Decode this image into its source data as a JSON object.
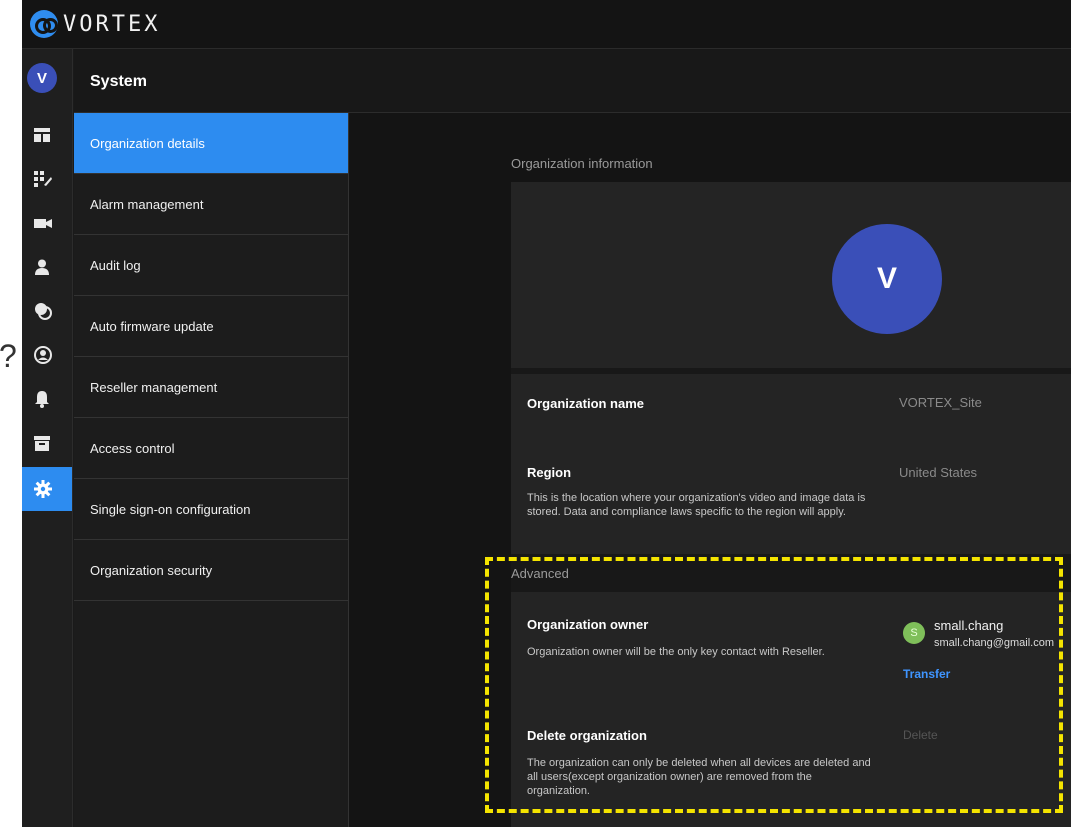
{
  "app": {
    "brand": "VORTEX"
  },
  "rail": {
    "avatar_letter": "V",
    "items": [
      {
        "icon": "dashboard-icon"
      },
      {
        "icon": "apps-icon"
      },
      {
        "icon": "camera-icon"
      },
      {
        "icon": "user-icon"
      },
      {
        "icon": "integration-icon"
      },
      {
        "icon": "account-circle-icon"
      },
      {
        "icon": "bell-icon"
      },
      {
        "icon": "archive-icon"
      },
      {
        "icon": "gear-icon",
        "active": true
      }
    ],
    "accent": "#2d8cf0"
  },
  "header": {
    "title": "System"
  },
  "menu": {
    "items": [
      {
        "label": "Organization details",
        "active": true
      },
      {
        "label": "Alarm management"
      },
      {
        "label": "Audit log"
      },
      {
        "label": "Auto firmware update"
      },
      {
        "label": "Reseller management"
      },
      {
        "label": "Access control"
      },
      {
        "label": "Single sign-on configuration"
      },
      {
        "label": "Organization security"
      }
    ]
  },
  "org_info": {
    "section_label": "Organization information",
    "avatar_letter": "V",
    "name_label": "Organization name",
    "name_value": "VORTEX_Site",
    "region_label": "Region",
    "region_desc_line1": "This is the location where your organization's video and image data is",
    "region_desc_line2": "stored. Data and compliance laws specific to the region will apply.",
    "region_value": "United States"
  },
  "advanced": {
    "section_label": "Advanced",
    "owner_label": "Organization owner",
    "owner_desc": "Organization owner will be the only key contact with Reseller.",
    "owner_initial": "S",
    "owner_name": "small.chang",
    "owner_email": "small.chang@gmail.com",
    "transfer_label": "Transfer",
    "delete_label": "Delete organization",
    "delete_desc_line1": "The organization can only be deleted when all devices are deleted and",
    "delete_desc_line2": "all users(except organization owner) are removed from the",
    "delete_desc_line3": "organization.",
    "delete_action": "Delete"
  },
  "overlay": {
    "question_mark": "?",
    "highlight_color": "#f4e400"
  }
}
